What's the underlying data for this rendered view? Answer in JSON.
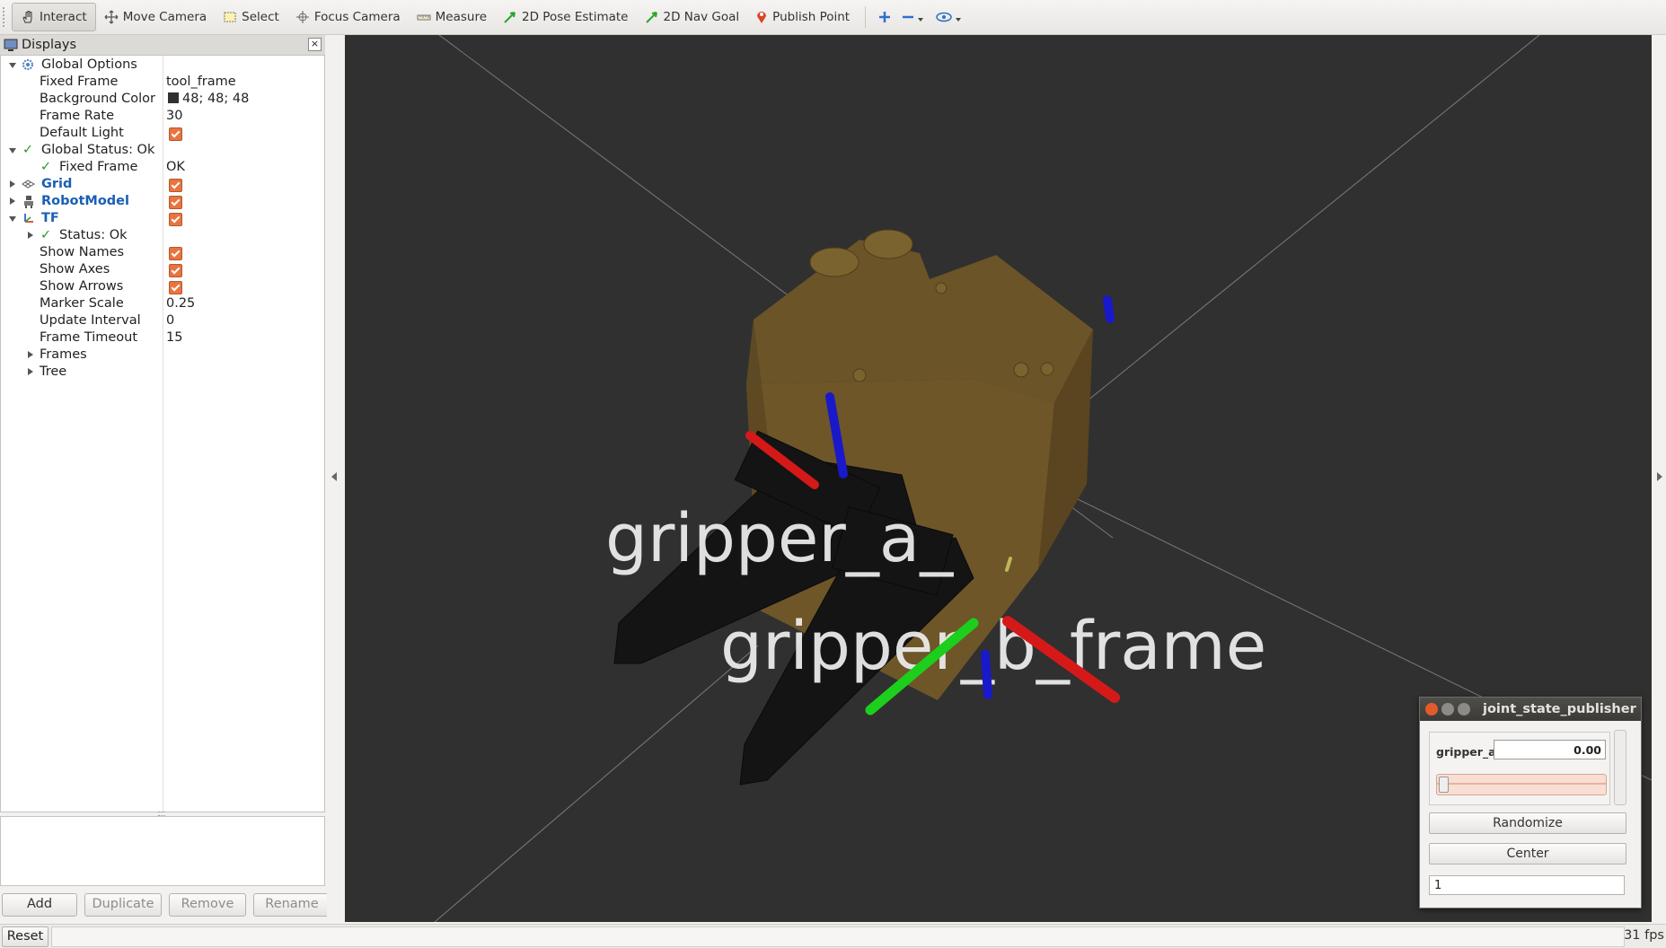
{
  "toolbar": {
    "interact": "Interact",
    "move_camera": "Move Camera",
    "select": "Select",
    "focus_camera": "Focus Camera",
    "measure": "Measure",
    "pose_estimate": "2D Pose Estimate",
    "nav_goal": "2D Nav Goal",
    "publish_point": "Publish Point"
  },
  "displays": {
    "title": "Displays",
    "rows": {
      "global_options": "Global Options",
      "fixed_frame_label": "Fixed Frame",
      "fixed_frame_value": "tool_frame",
      "background_color_label": "Background Color",
      "background_color_value": "48; 48; 48",
      "frame_rate_label": "Frame Rate",
      "frame_rate_value": "30",
      "default_light_label": "Default Light",
      "global_status": "Global Status: Ok",
      "status_fixed_frame_label": "Fixed Frame",
      "status_fixed_frame_value": "OK",
      "grid": "Grid",
      "robot_model": "RobotModel",
      "tf": "TF",
      "tf_status": "Status: Ok",
      "show_names": "Show Names",
      "show_axes": "Show Axes",
      "show_arrows": "Show Arrows",
      "marker_scale_label": "Marker Scale",
      "marker_scale_value": "0.25",
      "update_interval_label": "Update Interval",
      "update_interval_value": "0",
      "frame_timeout_label": "Frame Timeout",
      "frame_timeout_value": "15",
      "frames": "Frames",
      "tree": "Tree"
    },
    "buttons": {
      "add": "Add",
      "duplicate": "Duplicate",
      "remove": "Remove",
      "rename": "Rename"
    }
  },
  "viewport": {
    "label_a": "gripper_a_",
    "label_b": "gripper_b_frame"
  },
  "joint_state_publisher": {
    "title": "joint_state_publisher",
    "joint_name": "gripper_a",
    "joint_value": "0.00",
    "slider_fraction": 0.0,
    "randomize": "Randomize",
    "center": "Center",
    "spin_value": "1"
  },
  "status_bar": {
    "reset": "Reset",
    "fps": "31 fps"
  },
  "colors": {
    "background": "#303030",
    "checkbox": "#e9743f",
    "link_blue": "#1a5fb4",
    "gripper_body": "#6b5428"
  }
}
